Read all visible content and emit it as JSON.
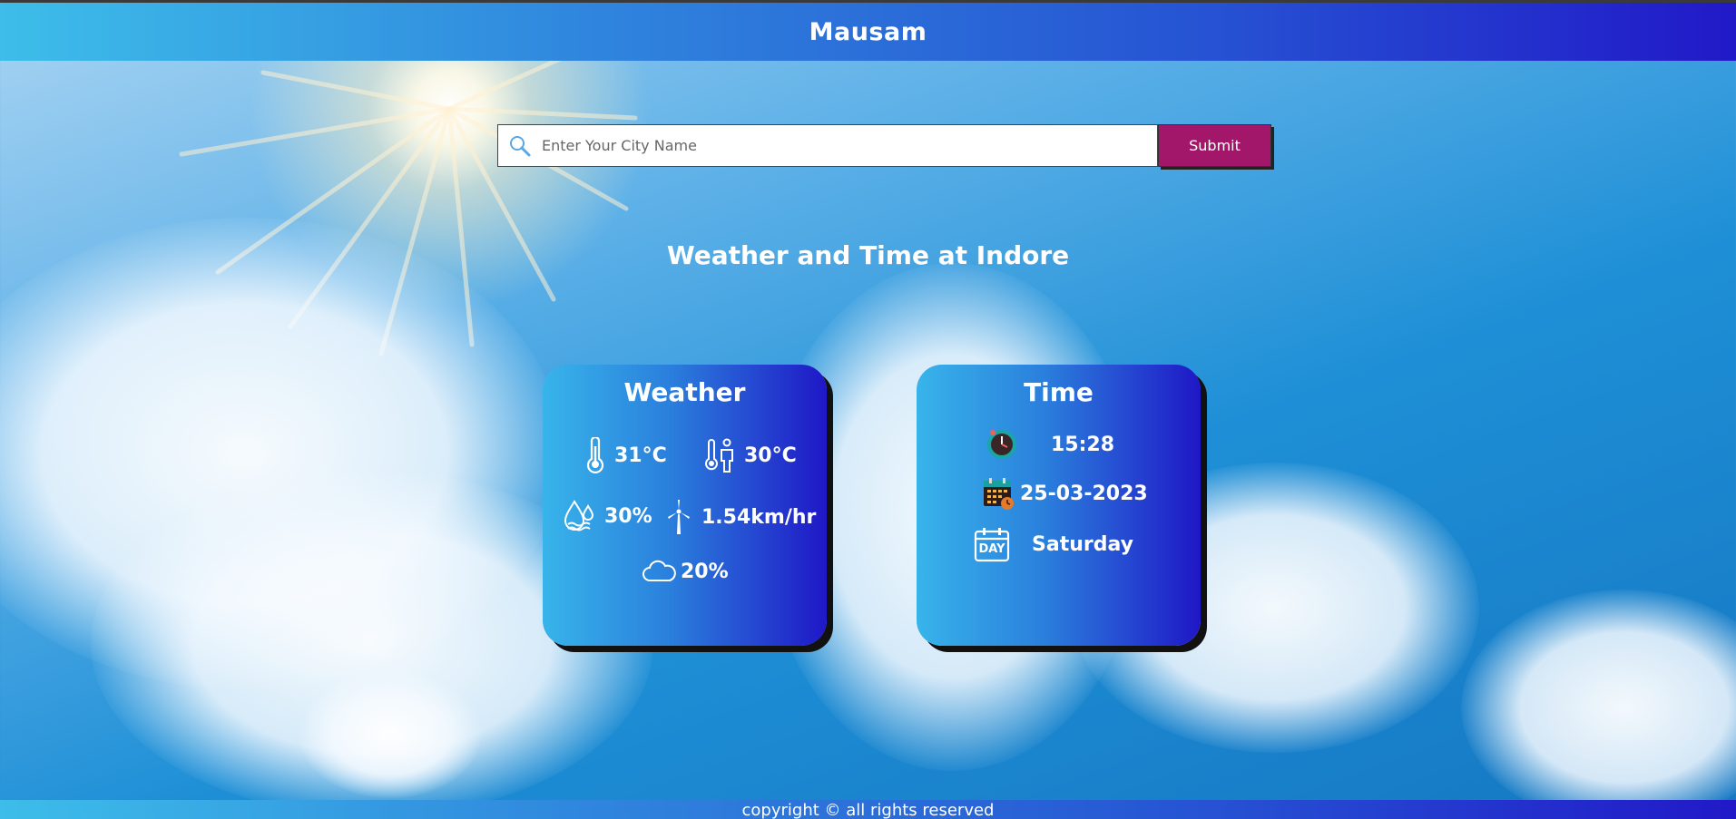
{
  "app": {
    "brand": "Mausam"
  },
  "search": {
    "placeholder": "Enter Your City Name",
    "value": "",
    "submit_label": "Submit"
  },
  "heading": "Weather and Time at Indore",
  "weather_card": {
    "title": "Weather",
    "temperature": "31°C",
    "feels_like": "30°C",
    "humidity": "30%",
    "wind_speed": "1.54km/hr",
    "cloudiness": "20%"
  },
  "time_card": {
    "title": "Time",
    "time": "15:28",
    "date": "25-03-2023",
    "day": "Saturday",
    "day_icon_text": "DAY"
  },
  "footer": {
    "text": "copyright © all rights reserved"
  },
  "colors": {
    "submit": "#a3176a",
    "gradient_start": "#3dbde9",
    "gradient_end": "#2119c8"
  },
  "icons": [
    "search-icon",
    "thermometer-icon",
    "feels-like-icon",
    "humidity-icon",
    "wind-turbine-icon",
    "cloud-icon",
    "clock-icon",
    "calendar-icon",
    "day-calendar-icon"
  ]
}
